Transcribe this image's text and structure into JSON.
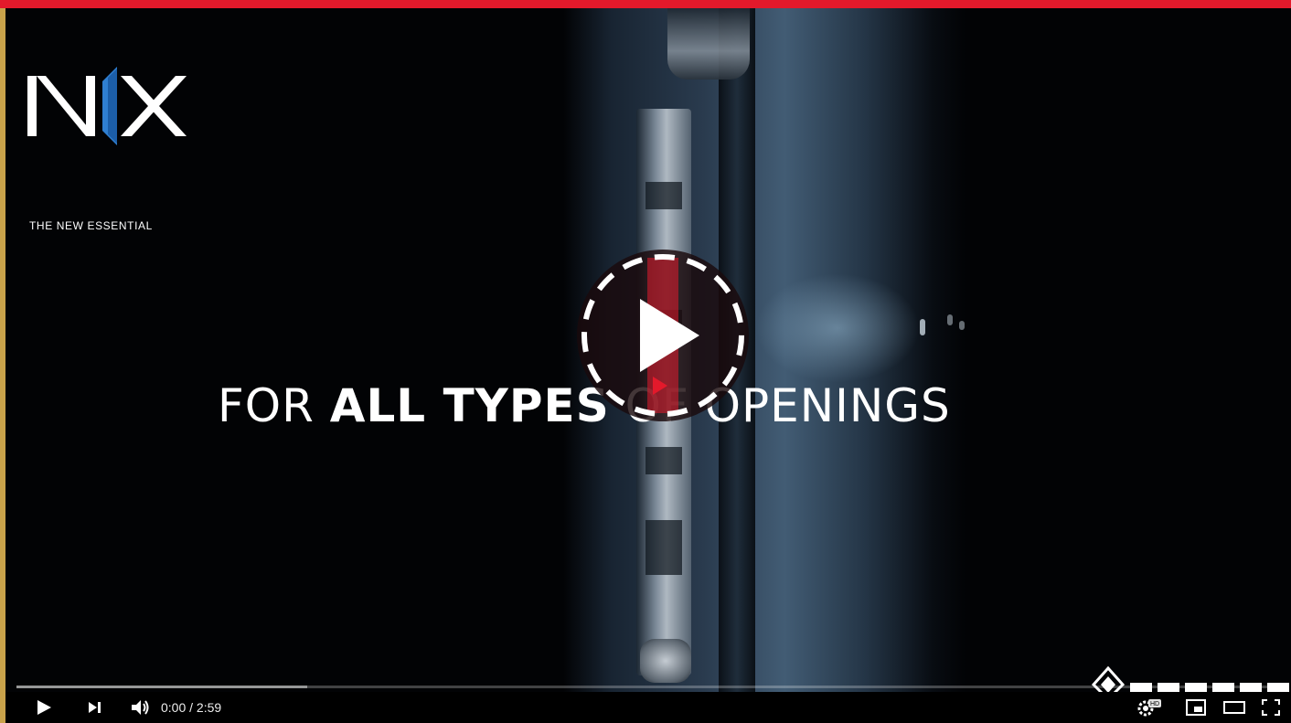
{
  "logo": {
    "tagline": "THE NEW ESSENTIAL"
  },
  "headline": {
    "part1": "FOR ",
    "part2": "ALL TYPES",
    "part3": " OF OPENINGS"
  },
  "player": {
    "time_display": "0:00 / 2:59",
    "progress_buffered": 0.23,
    "hd_badge": "HD"
  },
  "icons": {
    "play": "play-icon",
    "next": "next-icon",
    "volume": "volume-icon",
    "settings": "settings-icon",
    "miniplayer": "miniplayer-icon",
    "theater": "theater-mode-icon",
    "fullscreen": "fullscreen-icon"
  },
  "colors": {
    "accent_red": "#e3192b",
    "logo_blue": "#2f7fd1",
    "border_gold": "#c9a24a"
  }
}
